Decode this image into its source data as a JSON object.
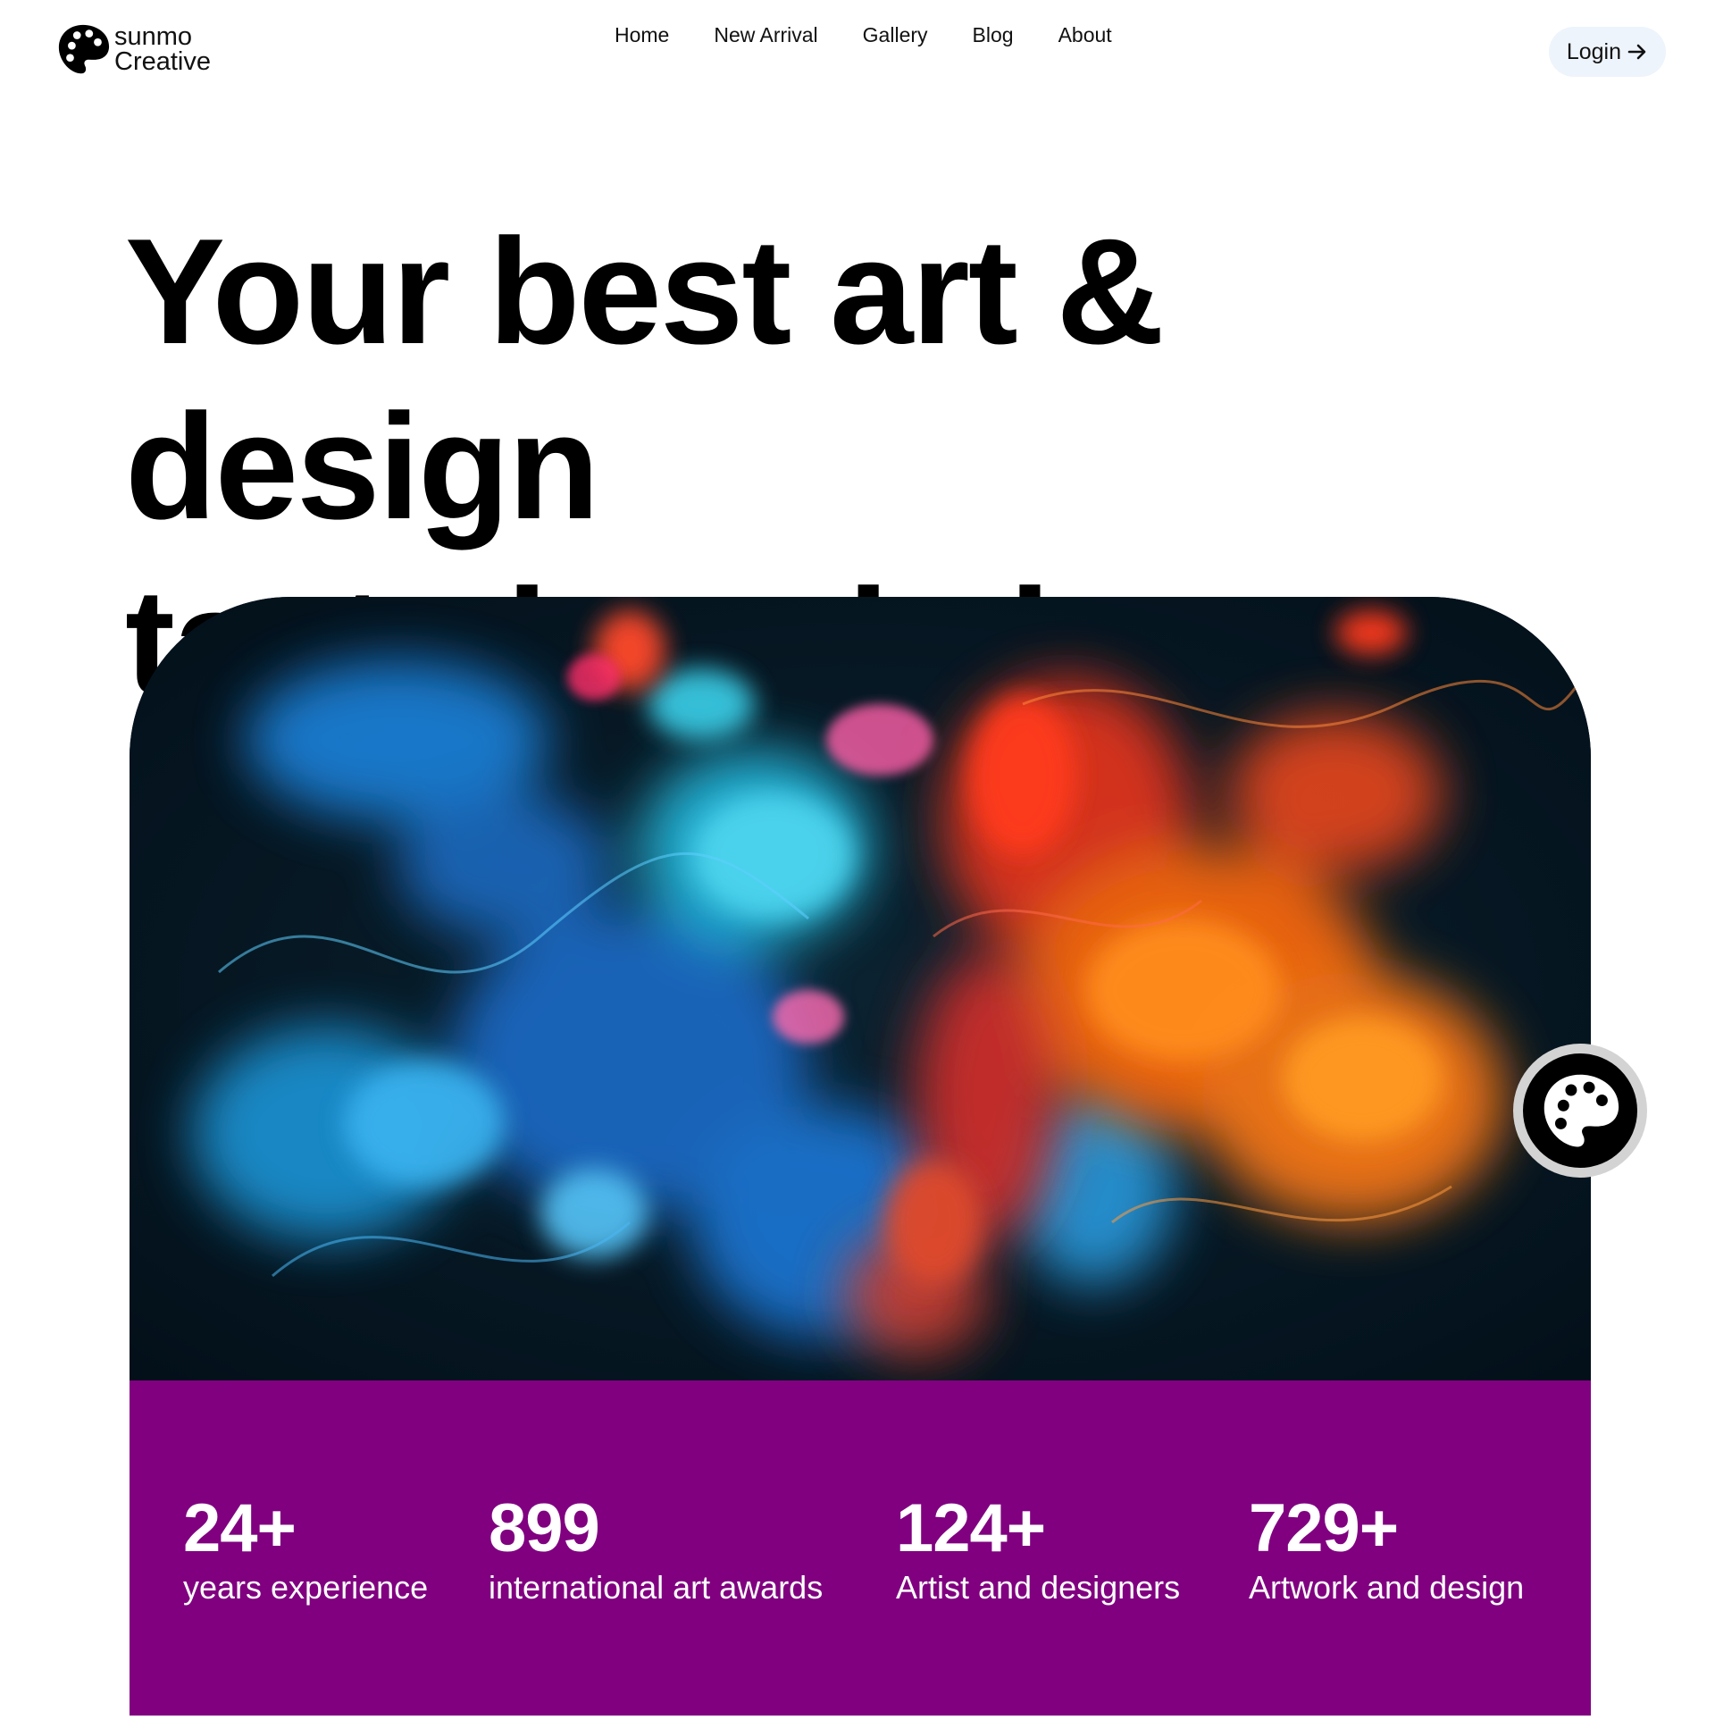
{
  "brand": {
    "line1": "sunmo",
    "line2": "Creative",
    "icon": "palette-icon"
  },
  "nav": {
    "items": [
      {
        "label": "Home"
      },
      {
        "label": "New Arrival"
      },
      {
        "label": "Gallery"
      },
      {
        "label": "Blog"
      },
      {
        "label": "About"
      }
    ]
  },
  "login": {
    "label": "Login",
    "icon": "arrow-right-icon"
  },
  "hero": {
    "title_line1": "Your best art & design",
    "title_line2": "taste is only here",
    "image_alt": "colorful ink in water"
  },
  "stats": {
    "items": [
      {
        "value": "24+",
        "label": "years experience"
      },
      {
        "value": "899",
        "label": "international art awards"
      },
      {
        "value": "124+",
        "label": "Artist and designers"
      },
      {
        "value": "729+",
        "label": "Artwork and design"
      }
    ]
  },
  "colors": {
    "accent_purple": "#800080",
    "login_bg": "#eef4fb",
    "fab_ring": "#d3d3d3"
  }
}
